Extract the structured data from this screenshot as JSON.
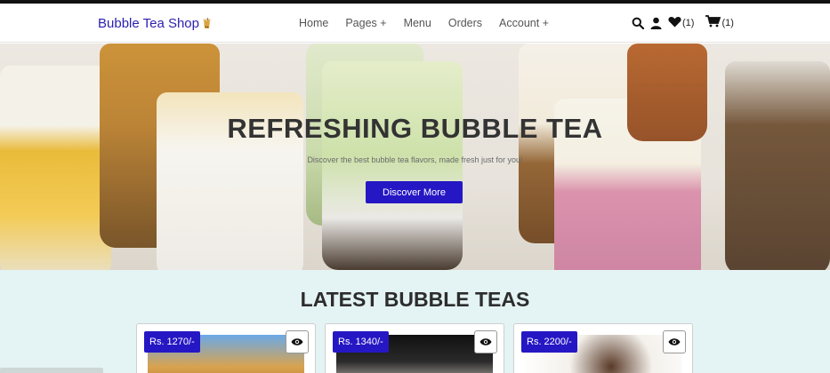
{
  "navbar": {
    "brand": "Bubble Tea Shop",
    "links": [
      "Home",
      "Pages +",
      "Menu",
      "Orders",
      "Account +"
    ],
    "wishlist_count": "(1)",
    "cart_count": "(1)"
  },
  "hero": {
    "title": "REFRESHING BUBBLE TEA",
    "subtitle": "Discover the best bubble tea flavors, made fresh just for you!",
    "button": "Discover More"
  },
  "latest": {
    "title": "LATEST BUBBLE TEAS",
    "products": [
      {
        "price": "Rs. 1270/-"
      },
      {
        "price": "Rs. 1340/-"
      },
      {
        "price": "Rs. 2200/-"
      }
    ]
  },
  "colors": {
    "accent": "#2617c4",
    "section_bg": "#e4f3f3"
  }
}
